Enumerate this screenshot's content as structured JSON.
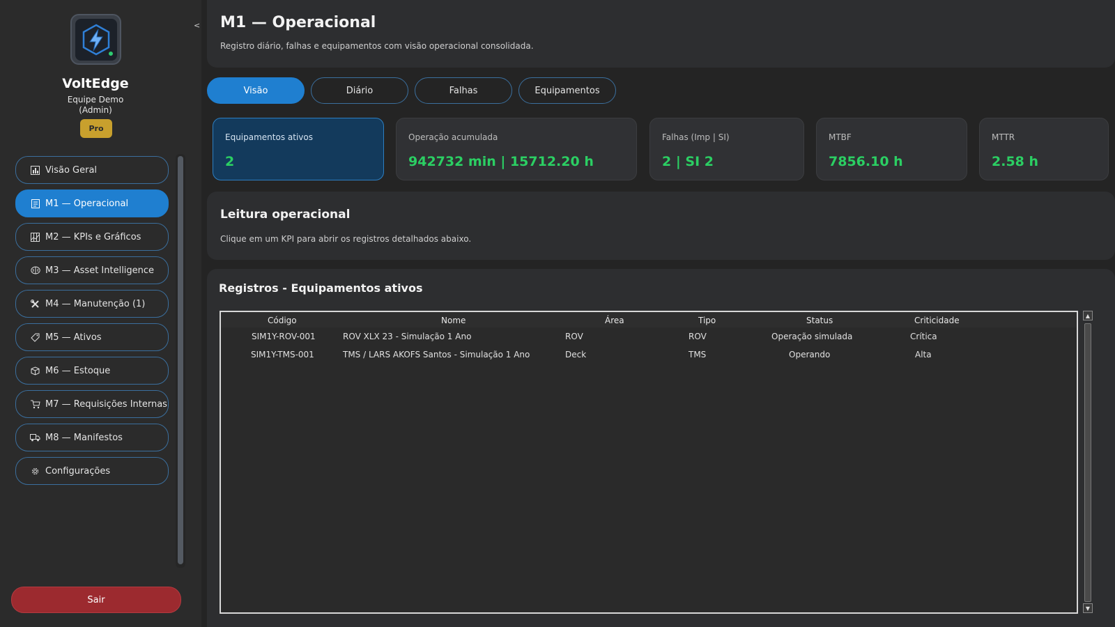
{
  "app": {
    "brand": "VoltEdge",
    "team": "Equipe Demo",
    "role": "(Admin)",
    "plan_badge": "Pro",
    "collapse_symbol": "<"
  },
  "sidebar": {
    "items": [
      {
        "label": "Visão Geral",
        "icon": "bar-chart-icon",
        "active": false
      },
      {
        "label": "M1 — Operacional",
        "icon": "clipboard-icon",
        "active": true
      },
      {
        "label": "M2 — KPIs e Gráficos",
        "icon": "chart-grid-icon",
        "active": false
      },
      {
        "label": "M3 — Asset Intelligence",
        "icon": "brain-icon",
        "active": false
      },
      {
        "label": "M4 — Manutenção (1)",
        "icon": "tools-icon",
        "active": false
      },
      {
        "label": "M5 — Ativos",
        "icon": "tag-icon",
        "active": false
      },
      {
        "label": "M6 — Estoque",
        "icon": "box-icon",
        "active": false
      },
      {
        "label": "M7 — Requisições Internas",
        "icon": "cart-icon",
        "active": false
      },
      {
        "label": "M8 — Manifestos",
        "icon": "truck-icon",
        "active": false
      },
      {
        "label": "Configurações",
        "icon": "gear-icon",
        "active": false
      }
    ],
    "logout_label": "Sair"
  },
  "header": {
    "title": "M1 — Operacional",
    "subtitle": "Registro diário, falhas e equipamentos com visão operacional consolidada."
  },
  "tabs": [
    {
      "label": "Visão",
      "active": true
    },
    {
      "label": "Diário",
      "active": false
    },
    {
      "label": "Falhas",
      "active": false
    },
    {
      "label": "Equipamentos",
      "active": false
    }
  ],
  "kpis": [
    {
      "label": "Equipamentos ativos",
      "value": "2",
      "active": true
    },
    {
      "label": "Operação acumulada",
      "value": "942732 min | 15712.20 h",
      "active": false
    },
    {
      "label": "Falhas (Imp | SI)",
      "value": "2 | SI 2",
      "active": false
    },
    {
      "label": "MTBF",
      "value": "7856.10 h",
      "active": false
    },
    {
      "label": "MTTR",
      "value": "2.58 h",
      "active": false
    }
  ],
  "reading": {
    "title": "Leitura operacional",
    "subtitle": "Clique em um KPI para abrir os registros detalhados abaixo."
  },
  "records": {
    "title": "Registros - Equipamentos ativos",
    "columns": [
      "Código",
      "Nome",
      "Área",
      "Tipo",
      "Status",
      "Criticidade"
    ],
    "rows": [
      [
        "SIM1Y-ROV-001",
        "ROV XLX 23 - Simulação 1 Ano",
        "ROV",
        "ROV",
        "Operação simulada",
        "Crítica"
      ],
      [
        "SIM1Y-TMS-001",
        "TMS / LARS AKOFS Santos - Simulação 1 Ano",
        "Deck",
        "TMS",
        "Operando",
        "Alta"
      ]
    ]
  },
  "colors": {
    "accent": "#1f7fd0",
    "kpi_value": "#2bcf63",
    "logout": "#9c2a2f",
    "badge": "#c8a02d"
  }
}
